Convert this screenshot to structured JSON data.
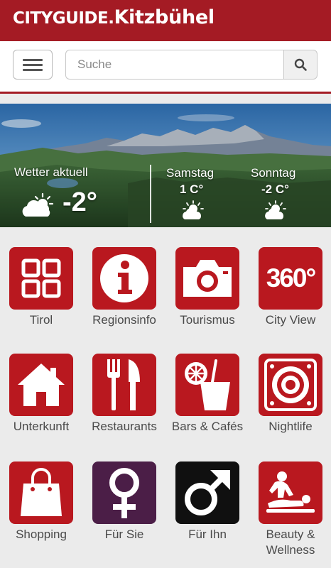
{
  "header": {
    "brand_part1": "CITYGUIDE.",
    "brand_part2": "Kitzbühel"
  },
  "search": {
    "placeholder": "Suche"
  },
  "weather": {
    "current_label": "Wetter aktuell",
    "current_temp": "-2°",
    "day1": {
      "label": "Samstag",
      "temp": "1 C°"
    },
    "day2": {
      "label": "Sonntag",
      "temp": "-2 C°"
    }
  },
  "tiles": [
    {
      "label": "Tirol",
      "icon": "grid-icon",
      "color": "#b9181f"
    },
    {
      "label": "Regionsinfo",
      "icon": "info-icon",
      "color": "#b9181f"
    },
    {
      "label": "Tourismus",
      "icon": "camera-icon",
      "color": "#b9181f"
    },
    {
      "label": "City View",
      "icon": "360-icon",
      "icon_text": "360°",
      "color": "#b9181f"
    },
    {
      "label": "Unterkunft",
      "icon": "house-icon",
      "color": "#b9181f"
    },
    {
      "label": "Restaurants",
      "icon": "fork-knife-icon",
      "color": "#b9181f"
    },
    {
      "label": "Bars & Cafés",
      "icon": "drink-icon",
      "color": "#b9181f"
    },
    {
      "label": "Nightlife",
      "icon": "speaker-icon",
      "color": "#b9181f"
    },
    {
      "label": "Shopping",
      "icon": "shopping-bag-icon",
      "color": "#b9181f"
    },
    {
      "label": "Für Sie",
      "icon": "female-symbol-icon",
      "color": "#4b1e47"
    },
    {
      "label": "Für Ihn",
      "icon": "male-symbol-icon",
      "color": "#101010"
    },
    {
      "label": "Beauty & Wellness",
      "icon": "massage-icon",
      "color": "#b9181f"
    }
  ]
}
